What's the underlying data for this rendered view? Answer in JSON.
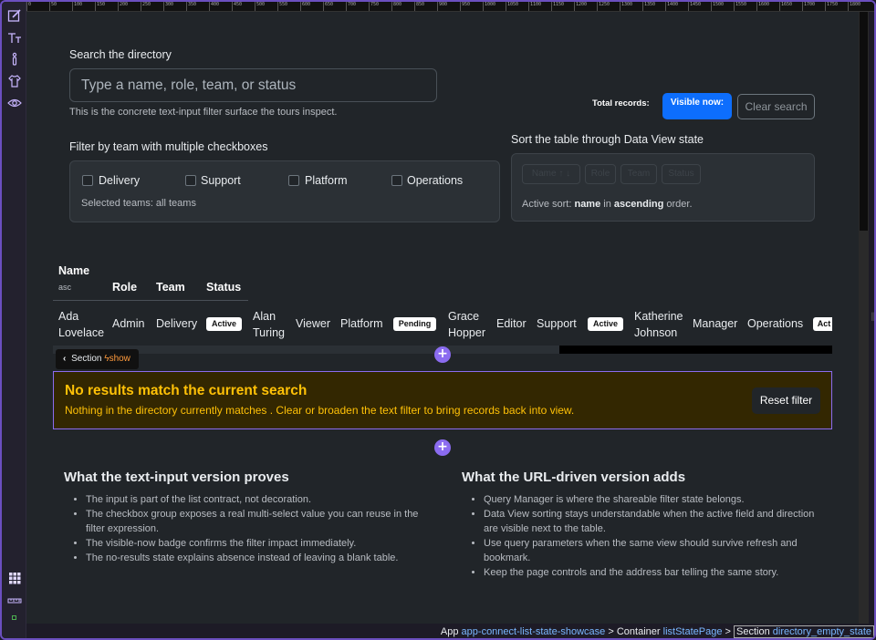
{
  "search": {
    "label": "Search the directory",
    "placeholder": "Type a name, role, team, or status",
    "help": "This is the concrete text-input filter surface the tours inspect."
  },
  "records": {
    "total_label": "Total records:",
    "visible_label": "Visible now:",
    "clear_label": "Clear search"
  },
  "team_filter": {
    "label": "Filter by team with multiple checkboxes",
    "options": [
      "Delivery",
      "Support",
      "Platform",
      "Operations"
    ],
    "selected_text": "Selected teams: all teams"
  },
  "sort": {
    "label": "Sort the table through Data View state",
    "buttons": [
      "Name ↑ ↓",
      "Role",
      "Team",
      "Status"
    ],
    "active_prefix": "Active sort: ",
    "active_field": "name",
    "active_mid": " in ",
    "active_dir": "ascending",
    "active_suffix": " order."
  },
  "table": {
    "headers": {
      "name": "Name",
      "name_sort": "asc",
      "role": "Role",
      "team": "Team",
      "status": "Status"
    },
    "rows": [
      {
        "name1": "Ada",
        "name2": "Lovelace",
        "role": "Admin",
        "team": "Delivery",
        "status": "Active"
      },
      {
        "name1": "Alan",
        "name2": "Turing",
        "role": "Viewer",
        "team": "Platform",
        "status": "Pending"
      },
      {
        "name1": "Grace",
        "name2": "Hopper",
        "role": "Editor",
        "team": "Support",
        "status": "Active"
      },
      {
        "name1": "Katherine",
        "name2": "Johnson",
        "role": "Manager",
        "team": "Operations",
        "status": "Act"
      }
    ]
  },
  "section_tag": {
    "label": "Section",
    "state": "show"
  },
  "empty_state": {
    "heading": "No results match the current search",
    "body": "Nothing in the directory currently matches . Clear or broaden the text filter to bring records back into view.",
    "reset_label": "Reset filter"
  },
  "text_input_col": {
    "heading": "What the text-input version proves",
    "items": [
      "The input is part of the list contract, not decoration.",
      "The checkbox group exposes a real multi-select value you can reuse in the filter expression.",
      "The visible-now badge confirms the filter impact immediately.",
      "The no-results state explains absence instead of leaving a blank table."
    ]
  },
  "url_col": {
    "heading": "What the URL-driven version adds",
    "items": [
      "Query Manager is where the shareable filter state belongs.",
      "Data View sorting stays understandable when the active field and direction are visible next to the table.",
      "Use query parameters when the same view should survive refresh and bookmark.",
      "Keep the page controls and the address bar telling the same story."
    ]
  },
  "statusbar": {
    "app_label": "App",
    "app_name": "app-connect-list-state-showcase",
    "container_label": "Container",
    "container_name": "listStatePage",
    "section_label": "Section",
    "section_name": "directory_empty_state",
    "sep": ">"
  },
  "ruler": [
    "0",
    "50",
    "100",
    "150",
    "200",
    "250",
    "300",
    "350",
    "400",
    "450",
    "500",
    "550",
    "600",
    "650",
    "700",
    "750",
    "800",
    "850",
    "900",
    "950",
    "1000",
    "1050",
    "1100",
    "1150",
    "1200",
    "1250",
    "1300",
    "1350",
    "1400",
    "1450",
    "1500",
    "1550",
    "1600",
    "1650",
    "1700",
    "1750",
    "1800"
  ],
  "colors": {
    "accent": "#8b6cf0",
    "primary": "#0d6efd",
    "warning": "#ffc107",
    "warning_bg": "#332701"
  }
}
